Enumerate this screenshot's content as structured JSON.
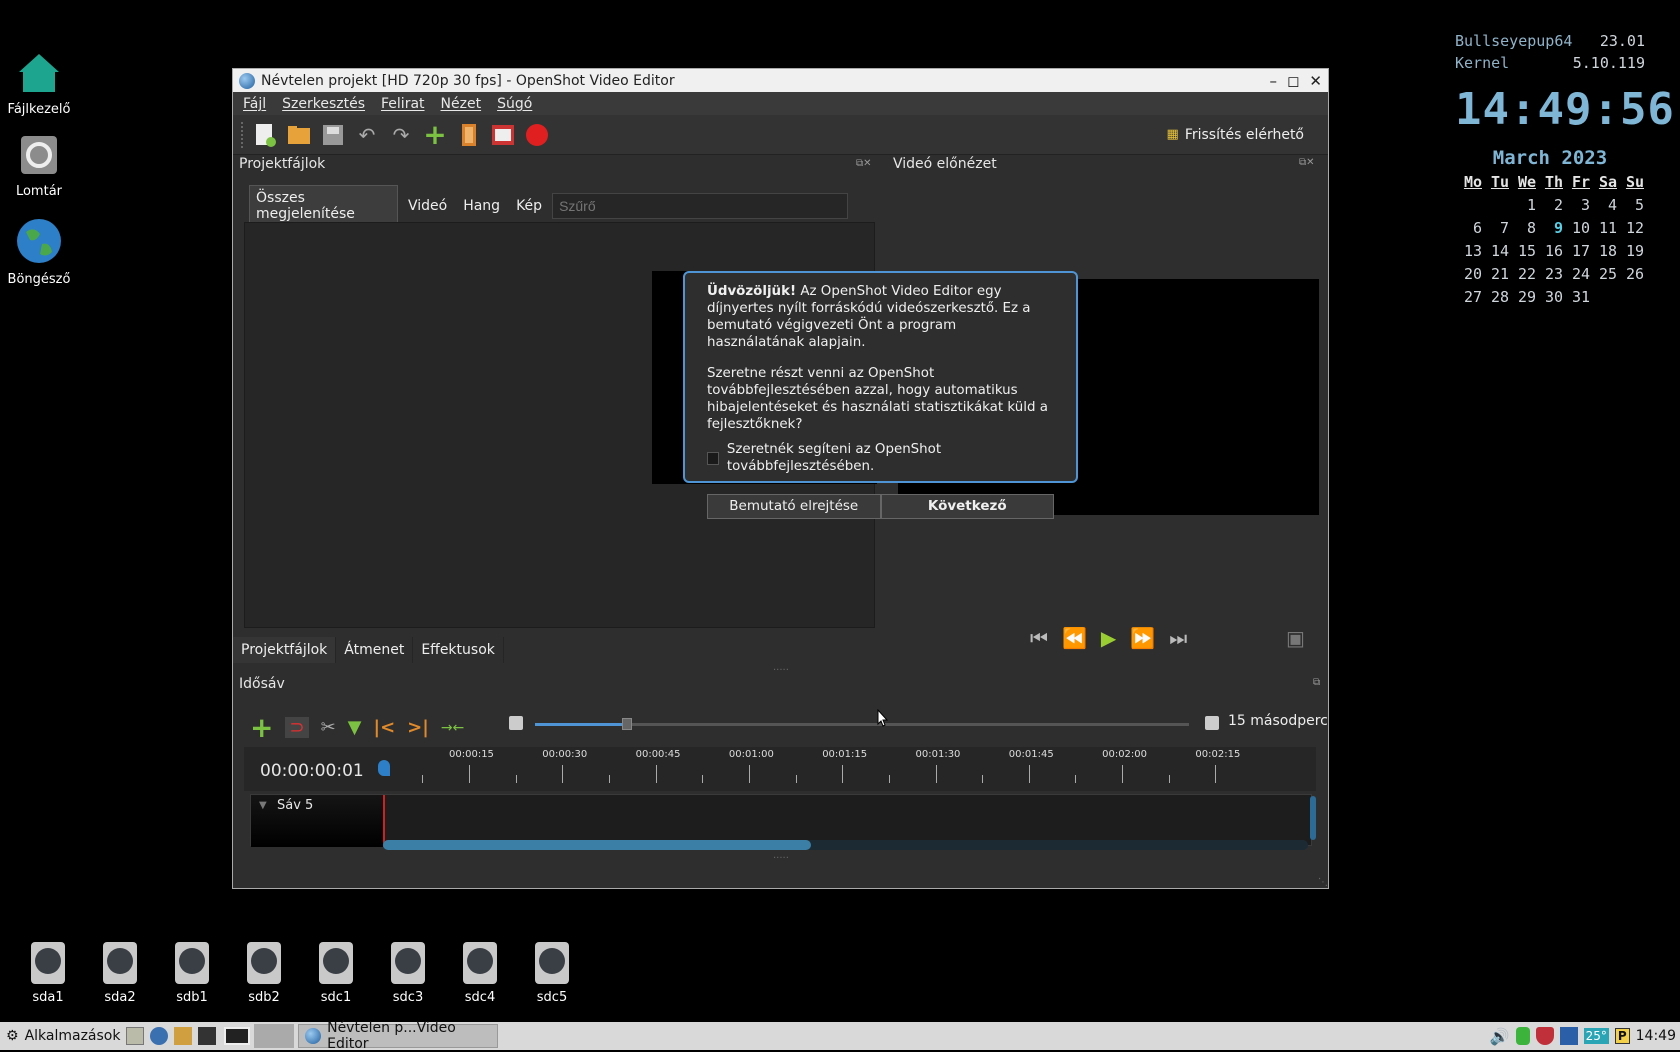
{
  "desktop": {
    "icons": [
      {
        "label": "Fájlkezelő",
        "icon": "home-icon"
      },
      {
        "label": "Lomtár",
        "icon": "trash-icon"
      },
      {
        "label": "Böngésző",
        "icon": "globe-icon"
      }
    ],
    "drives": [
      "sda1",
      "sda2",
      "sdb1",
      "sdb2",
      "sdc1",
      "sdc3",
      "sdc4",
      "sdc5"
    ]
  },
  "conky": {
    "host_label": "Bullseyepup64",
    "host_value": "23.01",
    "kernel_label": "Kernel",
    "kernel_value": "5.10.119",
    "time": "14:49:56",
    "month": "March  2023",
    "weekdays": [
      "Mo",
      "Tu",
      "We",
      "Th",
      "Fr",
      "Sa",
      "Su"
    ],
    "weeks": [
      [
        "",
        "",
        "1",
        "2",
        "3",
        "4",
        "5"
      ],
      [
        "6",
        "7",
        "8",
        "9",
        "10",
        "11",
        "12"
      ],
      [
        "13",
        "14",
        "15",
        "16",
        "17",
        "18",
        "19"
      ],
      [
        "20",
        "21",
        "22",
        "23",
        "24",
        "25",
        "26"
      ],
      [
        "27",
        "28",
        "29",
        "30",
        "31",
        "",
        ""
      ]
    ],
    "today": "9"
  },
  "window": {
    "title": "Névtelen projekt [HD 720p 30 fps] - OpenShot Video Editor",
    "menu": [
      "Fájl",
      "Szerkesztés",
      "Felirat",
      "Nézet",
      "Súgó"
    ],
    "update_label": "Frissítés elérhető"
  },
  "project_files": {
    "title": "Projektfájlok",
    "filters": [
      "Összes megjelenítése",
      "Videó",
      "Hang",
      "Kép"
    ],
    "filter_placeholder": "Szűrő",
    "tabs": [
      "Projektfájlok",
      "Átmenet",
      "Effektusok"
    ]
  },
  "preview": {
    "title": "Videó előnézet"
  },
  "dialog": {
    "bold_intro": "Üdvözöljük!",
    "intro": " Az OpenShot Video Editor egy díjnyertes nyílt forráskódú videószerkesztő. Ez a bemutató végigvezeti Önt a program használatának alapjain.",
    "question": "Szeretne részt venni az OpenShot továbbfejlesztésében azzal, hogy automatikus hibajelentéseket és használati statisztikákat küld a fejlesztőknek?",
    "checkbox_label": "Szeretnék segíteni az OpenShot továbbfejlesztésében.",
    "hide_button": "Bemutató elrejtése",
    "next_button": "Következő"
  },
  "timeline": {
    "title": "Idősáv",
    "zoom_label": "15 másodperc",
    "zoom_level": 0.14,
    "timecode": "00:00:00:01",
    "ruler": [
      "00:00:15",
      "00:00:30",
      "00:00:45",
      "00:01:00",
      "00:01:15",
      "00:01:30",
      "00:01:45",
      "00:02:00",
      "00:02:15"
    ],
    "track_name": "Sáv 5"
  },
  "taskbar": {
    "apps_label": "Alkalmazások",
    "task": "Névtelen p...Video Editor",
    "temp": "25°",
    "clock": "14:49"
  },
  "colors": {
    "accent": "#4f94d4",
    "play": "#9acd32",
    "record": "#e02020",
    "conky_blue": "#7fb6d6"
  }
}
